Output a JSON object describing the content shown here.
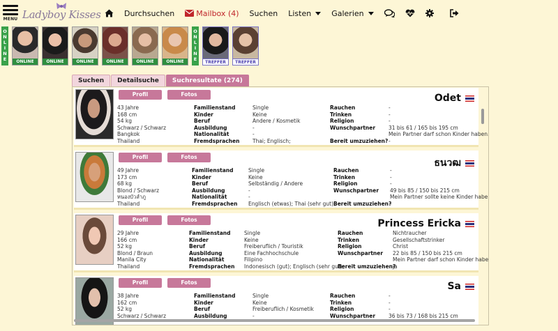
{
  "header": {
    "menu_label": "MENU",
    "logo_text": "Ladyboy Kisses",
    "nav": {
      "durchsuchen": "Durchsuchen",
      "mailbox": "Mailbox (4)",
      "suchen": "Suchen",
      "listen": "Listen",
      "galerien": "Galerien"
    },
    "icons": [
      "home-icon",
      "envelope-icon",
      "chat-icon",
      "heartbeat-icon",
      "gear-icon",
      "logout-icon"
    ]
  },
  "online_strip": {
    "badge_text": "ONLINE",
    "online_tag": "ONLINE",
    "treffer_tag": "TREFFER"
  },
  "tabs": [
    "Suchen",
    "Detailsuche",
    "Suchresultate (274)"
  ],
  "field_labels": {
    "familienstand": "Familienstand",
    "kinder": "Kinder",
    "beruf": "Beruf",
    "ausbildung": "Ausbildung",
    "nationalitaet": "Nationalität",
    "fremdsprachen": "Fremdsprachen",
    "rauchen": "Rauchen",
    "trinken": "Trinken",
    "religion": "Religion",
    "wunschpartner": "Wunschpartner",
    "umzug": "Bereit umzuziehen?"
  },
  "buttons": {
    "profil": "Profil",
    "fotos": "Fotos"
  },
  "profiles": [
    {
      "name": "Odet",
      "basic": [
        "43 Jahre",
        "168 cm",
        "54 kg",
        "Schwarz / Schwarz",
        "Bangkok",
        "Thailand"
      ],
      "values": [
        "Single",
        "Keine",
        "Andere / Kosmetik",
        "-",
        "-",
        "Thai;  Englisch;"
      ],
      "right": [
        "-",
        "-",
        "-",
        "31 bis 61  /  165 bis 195 cm",
        "Mein Partner darf schon Kinder haben.",
        "-"
      ]
    },
    {
      "name": "ธนวฒ",
      "basic": [
        "49 Jahre",
        "173 cm",
        "68 kg",
        "Blond / Schwarz",
        "หนองบัวลำภู",
        "Thailand"
      ],
      "values": [
        "Single",
        "Keine",
        "Selbständig / Andere",
        "-",
        "-",
        "Englisch (etwas);  Thai (sehr gut);"
      ],
      "right": [
        "-",
        "-",
        "-",
        "49 bis 85  /  150 bis 215 cm",
        "Mein Partner sollte keine Kinder haben.",
        "-"
      ]
    },
    {
      "name": "Princess Ericka",
      "basic": [
        "29 Jahre",
        "166 cm",
        "52 kg",
        "Blond / Braun",
        "Manila City",
        "Thailand"
      ],
      "values": [
        "Single",
        "Keine",
        "Freiberuflich / Touristik",
        "Eine Fachhochschule",
        "Filipino",
        "Indonesisch (gut);  Englisch (sehr gut);"
      ],
      "right": [
        "Nichtraucher",
        "Gesellschaftstrinker",
        "Christ",
        "22 bis 85  /  150 bis 215 cm",
        "Mein Partner darf schon Kinder haben.",
        "ja"
      ]
    },
    {
      "name": "Sa",
      "basic": [
        "38 Jahre",
        "162 cm",
        "52 kg",
        "Schwarz / Schwarz"
      ],
      "values": [
        "Single",
        "Keine",
        "Freiberuflich / Kosmetik",
        "-"
      ],
      "right": [
        "-",
        "-",
        "-",
        "36 bis 73  /  168 bis 215 cm"
      ]
    }
  ],
  "colors": {
    "background": "#fdf6d6",
    "accent_pink": "#c7789a",
    "online_green": "#3aa24a",
    "mail_red": "#c0262b"
  }
}
